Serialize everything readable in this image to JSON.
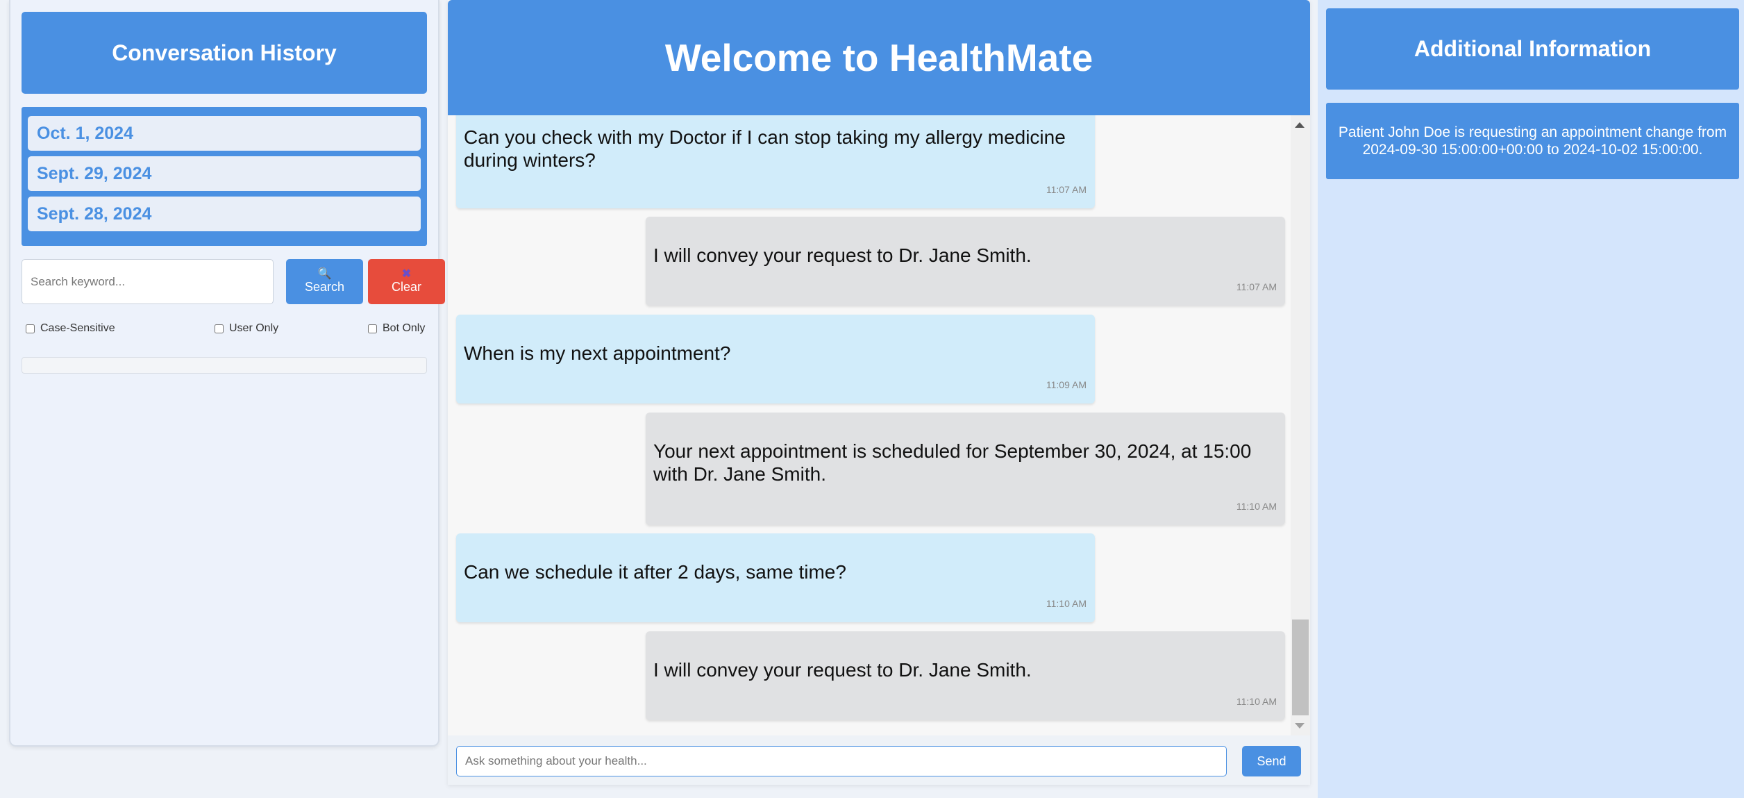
{
  "history": {
    "title": "Conversation History",
    "items": [
      "Oct. 1, 2024",
      "Sept. 29, 2024",
      "Sept. 28, 2024"
    ]
  },
  "search": {
    "placeholder": "Search keyword...",
    "search_label": "Search",
    "search_icon": "🔍",
    "clear_label": "Clear",
    "clear_icon": "✖"
  },
  "filters": {
    "case_sensitive": "Case-Sensitive",
    "user_only": "User Only",
    "bot_only": "Bot Only"
  },
  "header": {
    "title": "Welcome to HealthMate"
  },
  "messages": [
    {
      "sender": "user",
      "text": "Can you check with my Doctor if I can stop taking my allergy medicine during winters?",
      "time": "11:07 AM"
    },
    {
      "sender": "bot",
      "text": "I will convey your request to Dr. Jane Smith.",
      "time": "11:07 AM"
    },
    {
      "sender": "user",
      "text": "When is my next appointment?",
      "time": "11:09 AM"
    },
    {
      "sender": "bot",
      "text": "Your next appointment is scheduled for September 30, 2024, at 15:00 with Dr. Jane Smith.",
      "time": "11:10 AM"
    },
    {
      "sender": "user",
      "text": "Can we schedule it after 2 days, same time?",
      "time": "11:10 AM"
    },
    {
      "sender": "bot",
      "text": "I will convey your request to Dr. Jane Smith.",
      "time": "11:10 AM"
    }
  ],
  "chat_input": {
    "placeholder": "Ask something about your health...",
    "send_label": "Send"
  },
  "info": {
    "title": "Additional Information",
    "text": "Patient John Doe is requesting an appointment change from 2024-09-30 15:00:00+00:00 to 2024-10-02 15:00:00."
  },
  "colors": {
    "primary": "#4a90e2",
    "danger": "#e74c3c",
    "user_bubble": "#d1ecfa",
    "bot_bubble": "#e0e1e3"
  }
}
